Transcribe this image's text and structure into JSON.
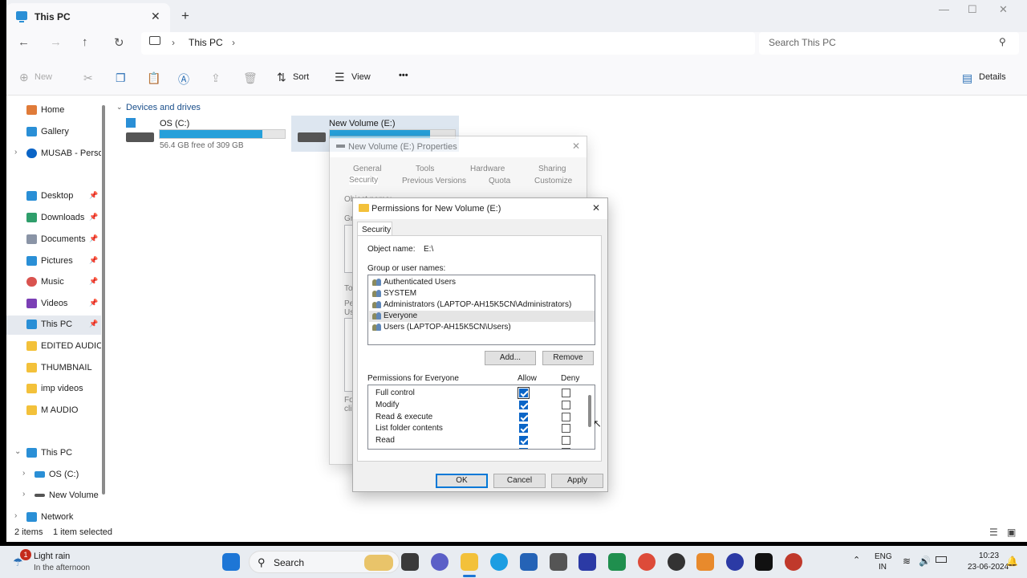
{
  "window": {
    "tab_title": "This PC",
    "tab_close": "✕",
    "new_tab": "+",
    "controls": {
      "minimize": "—",
      "maximize": "☐",
      "close": "✕"
    }
  },
  "navbar": {
    "breadcrumb": [
      "This PC"
    ],
    "search_placeholder": "Search This PC"
  },
  "toolbar": {
    "new_label": "New",
    "sort_label": "Sort",
    "view_label": "View",
    "more_label": "•••",
    "details_label": "Details"
  },
  "sidebar": {
    "items": [
      {
        "label": "Home",
        "icon": "home-icon",
        "color": "#e07b39"
      },
      {
        "label": "Gallery",
        "icon": "gallery-icon",
        "color": "#2a8fd6"
      },
      {
        "label": "MUSAB - Person",
        "icon": "onedrive-icon",
        "color": "#0a64c6"
      },
      {
        "label": "Desktop",
        "icon": "desktop-icon",
        "color": "#2a8fd6"
      },
      {
        "label": "Downloads",
        "icon": "downloads-icon",
        "color": "#2f9e6b"
      },
      {
        "label": "Documents",
        "icon": "documents-icon",
        "color": "#8a94a6"
      },
      {
        "label": "Pictures",
        "icon": "pictures-icon",
        "color": "#2a8fd6"
      },
      {
        "label": "Music",
        "icon": "music-icon",
        "color": "#d9534f"
      },
      {
        "label": "Videos",
        "icon": "videos-icon",
        "color": "#7b3fb5"
      },
      {
        "label": "This PC",
        "icon": "this-pc-icon",
        "color": "#2a8fd6"
      },
      {
        "label": "EDITED AUDIO",
        "icon": "folder-icon",
        "color": "#f3c13a"
      },
      {
        "label": "THUMBNAIL",
        "icon": "folder-icon",
        "color": "#f3c13a"
      },
      {
        "label": "imp videos",
        "icon": "folder-icon",
        "color": "#f3c13a"
      },
      {
        "label": "M AUDIO",
        "icon": "folder-icon",
        "color": "#f3c13a"
      },
      {
        "label": "This PC",
        "icon": "this-pc-icon",
        "color": "#2a8fd6"
      },
      {
        "label": "OS (C:)",
        "icon": "drive-icon",
        "color": "#2a8fd6"
      },
      {
        "label": "New Volume (I",
        "icon": "drive-icon",
        "color": "#555555"
      },
      {
        "label": "Network",
        "icon": "network-icon",
        "color": "#2a8fd6"
      }
    ]
  },
  "main": {
    "section_title": "Devices and drives",
    "drives": [
      {
        "name": "OS (C:)",
        "free_text": "56.4 GB free of 309 GB",
        "used_fraction": 0.82
      },
      {
        "name": "New Volume (E:)",
        "used_fraction": 0.8
      }
    ]
  },
  "status": {
    "item_count": "2 items",
    "selected": "1 item selected"
  },
  "properties_dialog": {
    "title": "New Volume (E:) Properties",
    "tabs_row1": [
      "General",
      "Tools",
      "Hardware",
      "Sharing"
    ],
    "tabs_row2": [
      "Security",
      "Previous Versions",
      "Quota",
      "Customize"
    ],
    "partial_labels": [
      "Object name:",
      "Gr",
      "To",
      "Pe",
      "Us",
      "Fo",
      "cli"
    ]
  },
  "permissions_dialog": {
    "title": "Permissions for New Volume (E:)",
    "tab": "Security",
    "object_label": "Object name:",
    "object_value": "E:\\",
    "group_label": "Group or user names:",
    "users": [
      "Authenticated Users",
      "SYSTEM",
      "Administrators (LAPTOP-AH15K5CN\\Administrators)",
      "Everyone",
      "Users (LAPTOP-AH15K5CN\\Users)"
    ],
    "selected_user_index": 3,
    "add_label": "Add...",
    "remove_label": "Remove",
    "perm_label": "Permissions for Everyone",
    "allow_label": "Allow",
    "deny_label": "Deny",
    "permissions": [
      {
        "name": "Full control",
        "allow": true,
        "deny": false
      },
      {
        "name": "Modify",
        "allow": true,
        "deny": false
      },
      {
        "name": "Read & execute",
        "allow": true,
        "deny": false
      },
      {
        "name": "List folder contents",
        "allow": true,
        "deny": false
      },
      {
        "name": "Read",
        "allow": true,
        "deny": false
      }
    ],
    "ok_label": "OK",
    "cancel_label": "Cancel",
    "apply_label": "Apply"
  },
  "taskbar": {
    "weather_title": "Light rain",
    "weather_sub": "In the afternoon",
    "weather_badge": "1",
    "search_label": "Search",
    "lang_top": "ENG",
    "lang_bottom": "IN",
    "time": "10:23",
    "date": "23-06-2024"
  }
}
